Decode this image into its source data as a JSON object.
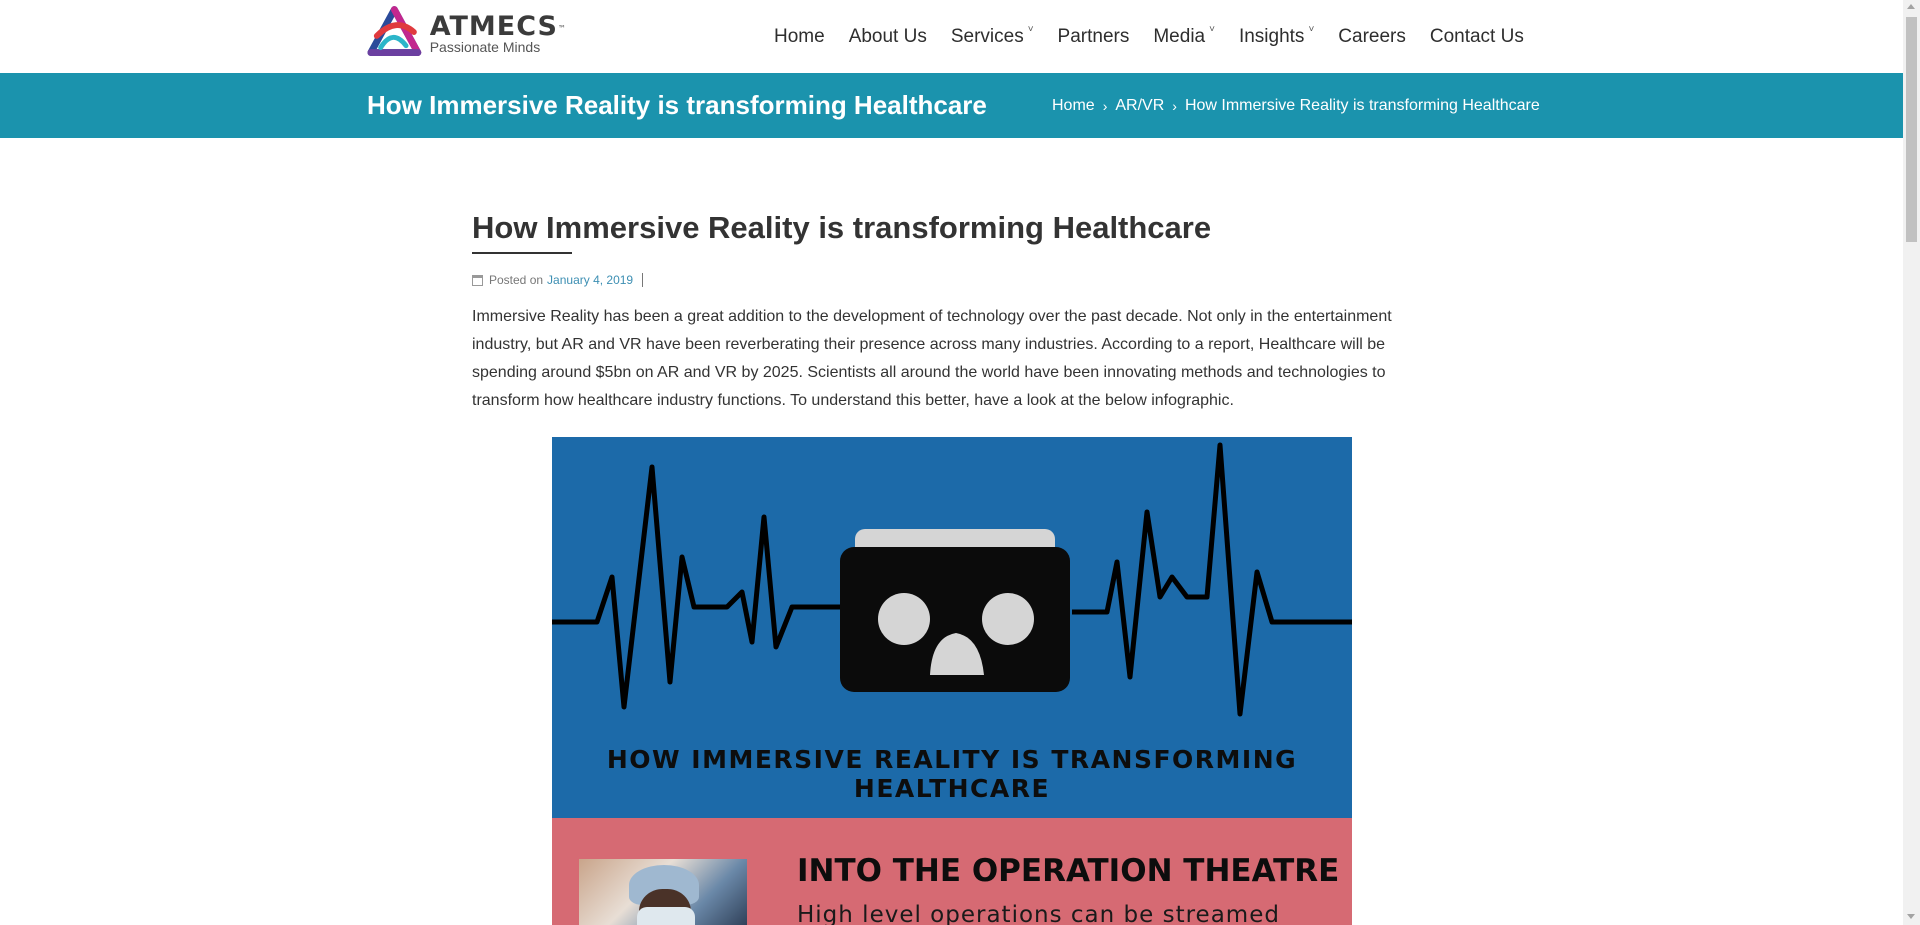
{
  "brand": {
    "name": "ATMECS",
    "trademark": "™",
    "tagline": "Passionate Minds"
  },
  "nav": {
    "items": [
      {
        "label": "Home",
        "has_dropdown": false
      },
      {
        "label": "About Us",
        "has_dropdown": false
      },
      {
        "label": "Services",
        "has_dropdown": true
      },
      {
        "label": "Partners",
        "has_dropdown": false
      },
      {
        "label": "Media",
        "has_dropdown": true
      },
      {
        "label": "Insights",
        "has_dropdown": true
      },
      {
        "label": "Careers",
        "has_dropdown": false
      },
      {
        "label": "Contact Us",
        "has_dropdown": false
      }
    ],
    "caret": "˅"
  },
  "banner": {
    "title": "How Immersive Reality is transforming Healthcare",
    "breadcrumb": [
      "Home",
      "AR/VR",
      "How Immersive Reality is transforming Healthcare"
    ],
    "separator": "›",
    "color": "#1b93ad"
  },
  "post": {
    "title": "How Immersive Reality is transforming Healthcare",
    "posted_prefix": "Posted on",
    "date": "January 4, 2019",
    "intro": "Immersive Reality has been a great addition to the development of technology over the past decade. Not only in the entertainment industry, but AR and VR have been reverberating their presence across many industries. According to a report, Healthcare will be spending around $5bn on AR and VR by 2025. Scientists all around the world have been innovating methods and technologies to transform how healthcare industry functions. To understand this better, have a look at the below infographic."
  },
  "infographic": {
    "heading": "HOW IMMERSIVE REALITY IS TRANSFORMING HEALTHCARE",
    "section_title": "INTO THE OPERATION THEATRE",
    "section_body": "High level operations can be streamed",
    "colors": {
      "top": "#1c6aa9",
      "bottom": "#d66a73",
      "headset": "#111111"
    }
  }
}
